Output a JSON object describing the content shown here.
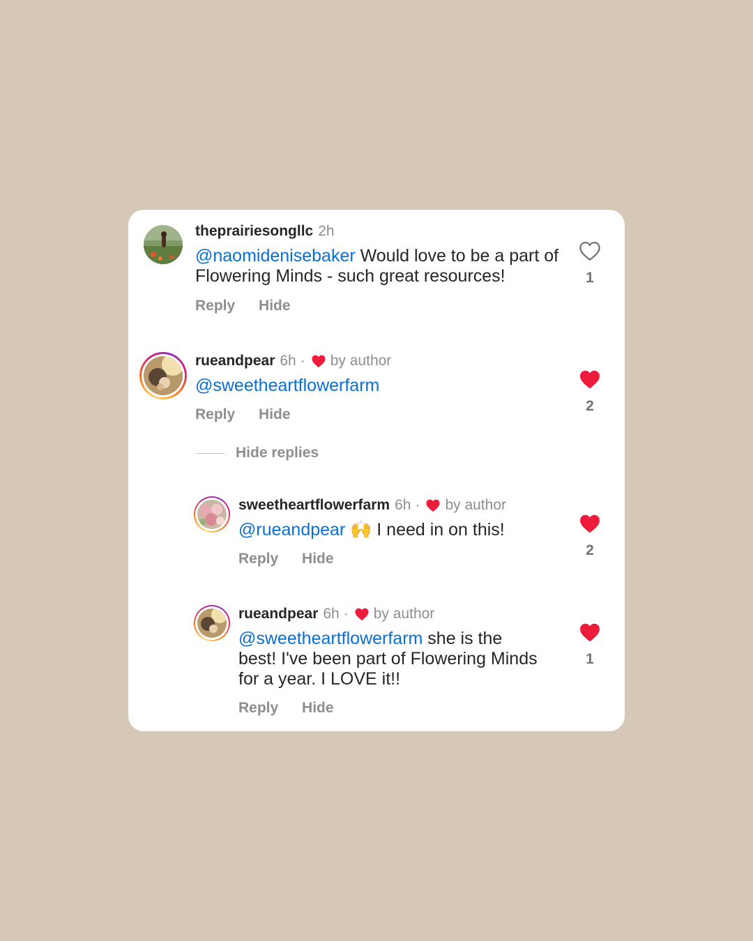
{
  "comments": [
    {
      "username": "theprairiesongllc",
      "time": "2h",
      "mention": "@naomidenisebaker",
      "text": " Would love to be a part of Flowering Minds - such great resources!",
      "reply_label": "Reply",
      "hide_label": "Hide",
      "likes": "1",
      "liked": false
    },
    {
      "username": "rueandpear",
      "time": "6h",
      "dot": "·",
      "by_author": "by author",
      "mention": "@sweetheartflowerfarm",
      "text": "",
      "reply_label": "Reply",
      "hide_label": "Hide",
      "likes": "2",
      "liked": true
    },
    {
      "username": "sweetheartflowerfarm",
      "time": "6h",
      "dot": "·",
      "by_author": "by author",
      "mention": "@rueandpear",
      "text": " 🙌 I need in on this!",
      "reply_label": "Reply",
      "hide_label": "Hide",
      "likes": "2",
      "liked": true
    },
    {
      "username": "rueandpear",
      "time": "6h",
      "dot": "·",
      "by_author": "by author",
      "mention": "@sweetheartflowerfarm",
      "text": " she is the best! I've been part of Flowering Minds for a year. I LOVE it!!",
      "reply_label": "Reply",
      "hide_label": "Hide",
      "likes": "1",
      "liked": true
    }
  ],
  "hide_replies_label": "Hide replies",
  "colors": {
    "background": "#d5c8b7",
    "mention": "#0a6fd6",
    "heart": "#ed1c3a",
    "muted": "#8e8e8e"
  },
  "icons": {
    "like_outline": "heart-outline-icon",
    "like_filled": "heart-filled-icon"
  }
}
